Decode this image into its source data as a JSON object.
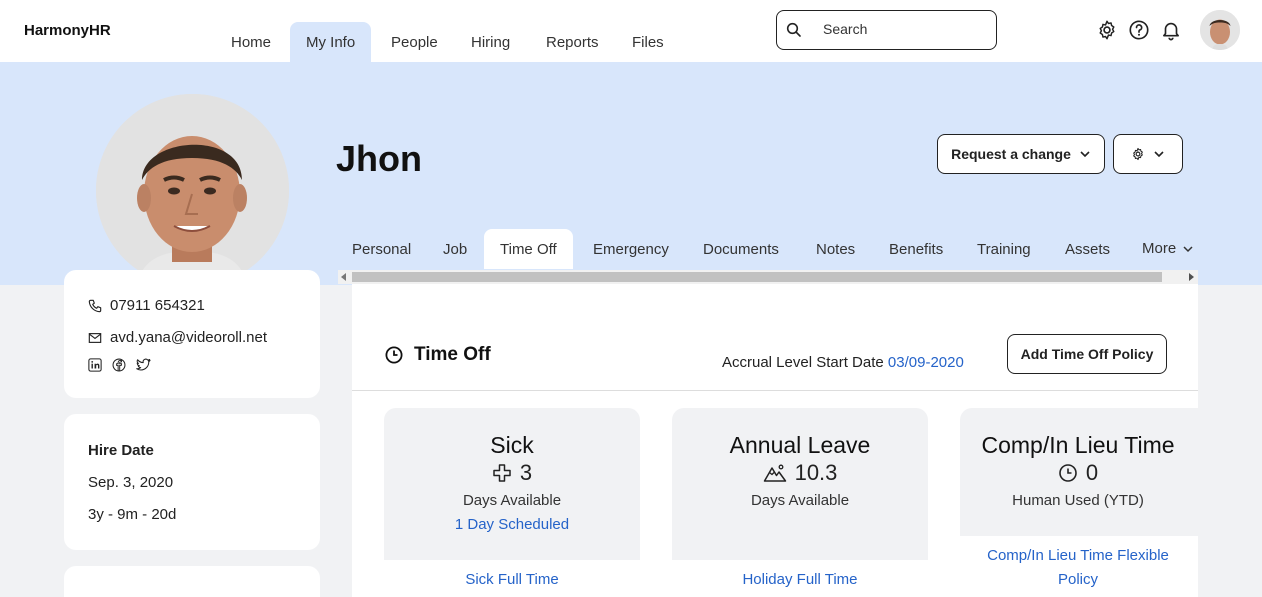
{
  "header": {
    "brand": "HarmonyHR",
    "nav": [
      "Home",
      "My Info",
      "People",
      "Hiring",
      "Reports",
      "Files"
    ],
    "active_nav": "My Info",
    "search_placeholder": "Search"
  },
  "profile": {
    "name": "Jhon",
    "request_change_label": "Request a change",
    "tabs": [
      "Personal",
      "Job",
      "Time Off",
      "Emergency",
      "Documents",
      "Notes",
      "Benefits",
      "Training",
      "Assets",
      "More"
    ],
    "active_tab": "Time Off"
  },
  "contact": {
    "phone": "07911 654321",
    "email": "avd.yana@videoroll.net"
  },
  "hire": {
    "label": "Hire Date",
    "date": "Sep. 3, 2020",
    "tenure": "3y - 9m - 20d"
  },
  "time_off": {
    "title": "Time Off",
    "accrual_label": "Accrual Level Start Date",
    "accrual_date": "03/09-2020",
    "add_policy_label": "Add Time Off Policy",
    "policies": [
      {
        "title": "Sick",
        "icon": "medical-cross-icon",
        "value": "3",
        "subtitle": "Days Available",
        "scheduled": "1 Day Scheduled",
        "policy": "Sick Full Time"
      },
      {
        "title": "Annual Leave",
        "icon": "mountain-icon",
        "value": "10.3",
        "subtitle": "Days Available",
        "scheduled": "",
        "policy": "Holiday Full Time"
      },
      {
        "title": "Comp/In Lieu Time",
        "icon": "clock-icon",
        "value": "0",
        "subtitle": "Human Used (YTD)",
        "scheduled": "",
        "policy_line1": "Comp/In Lieu Time Flexible",
        "policy_line2": "Policy"
      }
    ]
  },
  "colors": {
    "accent": "#2563c9",
    "band": "#d8e6fb",
    "page": "#f1f2f4"
  }
}
